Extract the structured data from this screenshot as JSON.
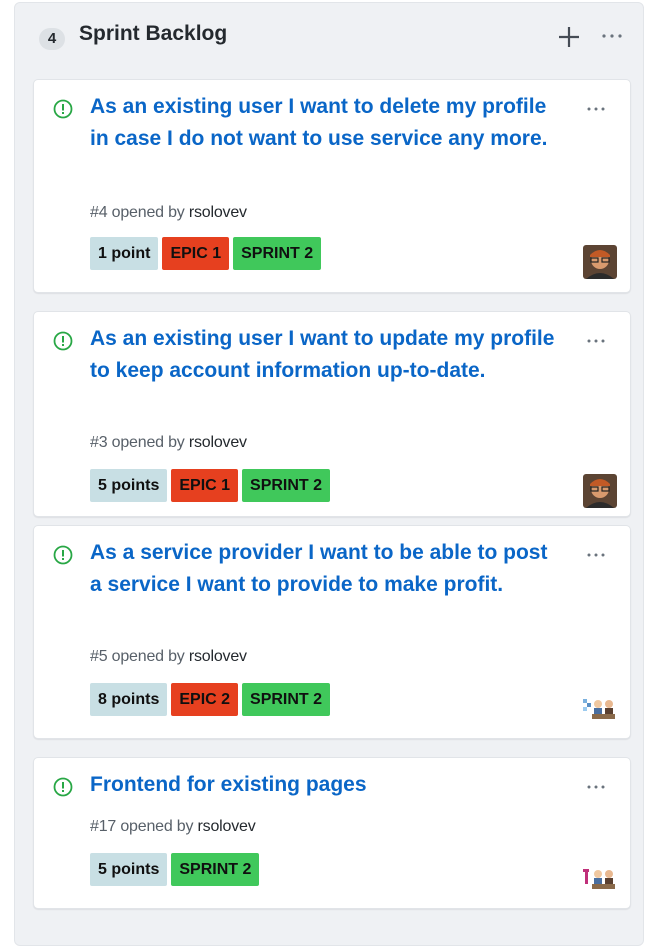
{
  "column": {
    "count": "4",
    "title": "Sprint Backlog",
    "add_icon": "plus-icon",
    "menu_icon": "ellipsis-icon"
  },
  "colors": {
    "title_link": "#0a66c7",
    "open_icon": "#28a745",
    "points_label": "#c8dfe4",
    "epic_label": "#e6401f",
    "sprint_label": "#40c85b",
    "column_bg": "#eff1f4"
  },
  "cards": [
    {
      "title": "As an existing user I want to delete my profile in case I do not want to use service any more.",
      "number": "#4",
      "opened_by": "opened by",
      "author": "rsolovev",
      "labels": [
        "1 point",
        "EPIC 1",
        "SPRINT 2"
      ],
      "avatar": "user-photo-avatar"
    },
    {
      "title": "As an existing user I want to update my profile to keep account information up-to-date.",
      "number": "#3",
      "opened_by": "opened by",
      "author": "rsolovev",
      "labels": [
        "5 points",
        "EPIC 1",
        "SPRINT 2"
      ],
      "avatar": "user-photo-avatar"
    },
    {
      "title": "As a service provider I want to be able to post a service I want to provide to make profit.",
      "number": "#5",
      "opened_by": "opened by",
      "author": "rsolovev",
      "labels": [
        "8 points",
        "EPIC 2",
        "SPRINT 2"
      ],
      "avatar": "team-avatar"
    },
    {
      "title": "Frontend for existing pages",
      "number": "#17",
      "opened_by": "opened by",
      "author": "rsolovev",
      "labels": [
        "5 points",
        "SPRINT 2"
      ],
      "avatar": "team-avatar"
    }
  ]
}
